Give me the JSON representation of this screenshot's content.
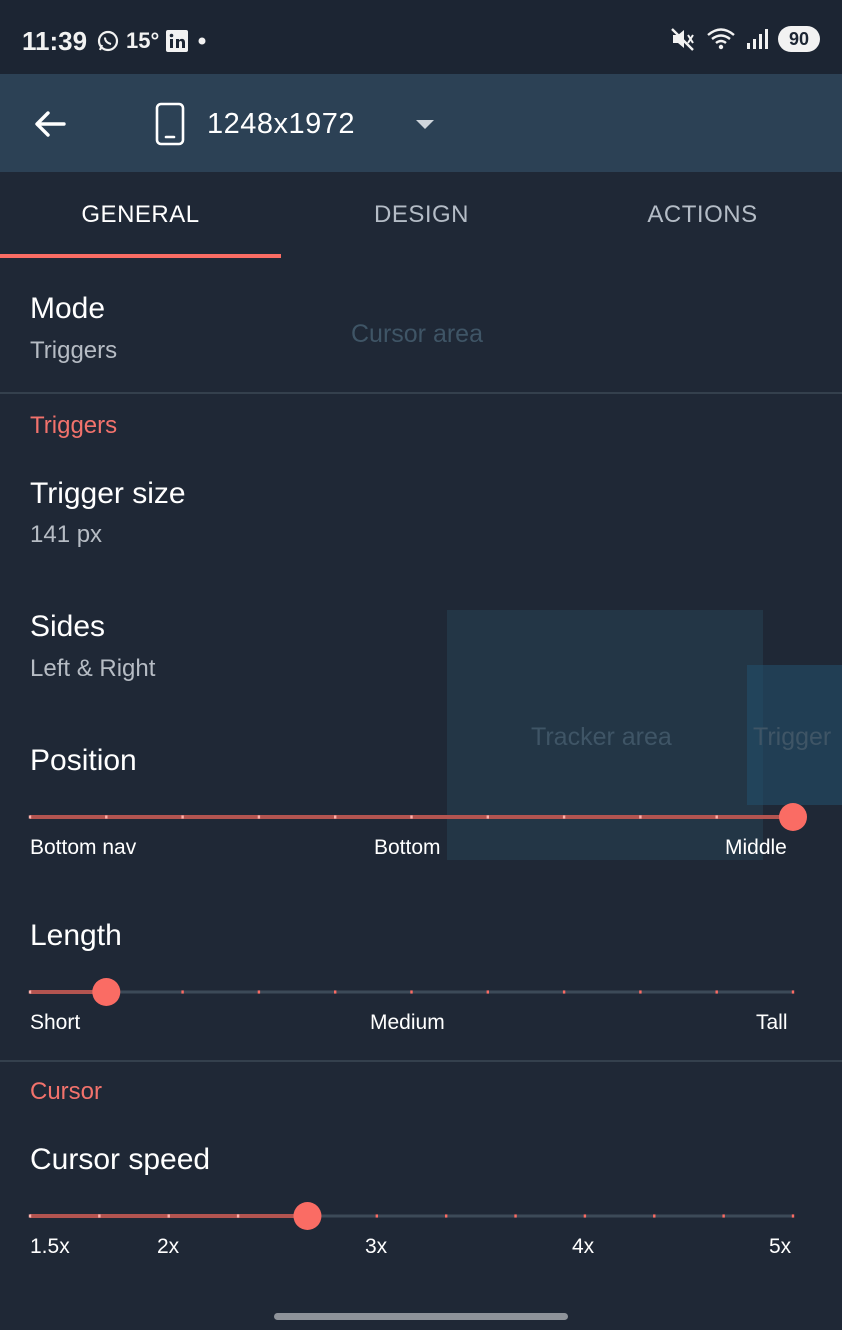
{
  "status_bar": {
    "time": "11:39",
    "temperature": "15°",
    "battery": "90",
    "icons": [
      "whatsapp-icon",
      "linkedin-icon",
      "notification-dot-icon",
      "mute-icon",
      "wifi-icon",
      "signal-icon"
    ]
  },
  "app_bar": {
    "resolution": "1248x1972"
  },
  "tabs": [
    {
      "label": "GENERAL",
      "active": true
    },
    {
      "label": "DESIGN",
      "active": false
    },
    {
      "label": "ACTIONS",
      "active": false
    }
  ],
  "general": {
    "mode": {
      "title": "Mode",
      "value": "Triggers"
    },
    "triggers_header": "Triggers",
    "trigger_size": {
      "title": "Trigger size",
      "value": "141 px"
    },
    "sides": {
      "title": "Sides",
      "value": "Left & Right"
    },
    "position": {
      "title": "Position",
      "labels": [
        "Bottom nav",
        "Bottom",
        "Middle"
      ],
      "steps": 11,
      "value_index": 10
    },
    "length": {
      "title": "Length",
      "labels": [
        "Short",
        "Medium",
        "Tall"
      ],
      "steps": 11,
      "value_index": 1
    },
    "cursor_header": "Cursor",
    "cursor_speed": {
      "title": "Cursor speed",
      "labels": [
        "1.5x",
        "2x",
        "3x",
        "4x",
        "5x"
      ],
      "steps": 12,
      "value_index": 4
    }
  },
  "overlays": {
    "cursor_area": "Cursor area",
    "tracker_area": "Tracker area",
    "trigger": "Trigger"
  },
  "colors": {
    "accent": "#fa6c64",
    "background": "#1f2836",
    "app_bar": "#2c4155"
  }
}
